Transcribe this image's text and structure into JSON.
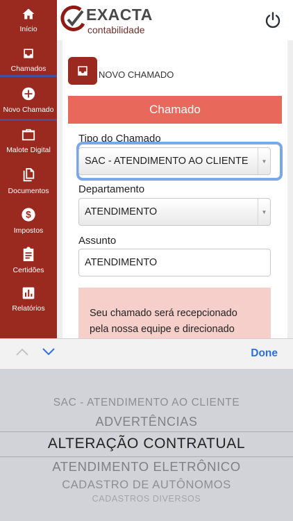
{
  "sidebar": {
    "items": [
      {
        "label": "Início",
        "icon": "home-icon"
      },
      {
        "label": "Chamados",
        "icon": "inbox-icon"
      },
      {
        "label": "Novo Chamado",
        "icon": "add-circle-icon"
      },
      {
        "label": "Malote Digital",
        "icon": "briefcase-icon"
      },
      {
        "label": "Documentos",
        "icon": "documents-icon"
      },
      {
        "label": "Impostos",
        "icon": "dollar-icon"
      },
      {
        "label": "Certidões",
        "icon": "clipboard-icon"
      },
      {
        "label": "Relatórios",
        "icon": "chart-icon"
      }
    ]
  },
  "header": {
    "logo_title": "EXACTA",
    "logo_subtitle": "contabilidade"
  },
  "page": {
    "title": "NOVO CHAMADO",
    "section_title": "Chamado"
  },
  "form": {
    "tipo_label": "Tipo do Chamado",
    "tipo_value": "SAC - ATENDIMENTO AO CLIENTE",
    "departamento_label": "Departamento",
    "departamento_value": "ATENDIMENTO",
    "assunto_label": "Assunto",
    "assunto_value": "ATENDIMENTO",
    "notice_line1": "Seu chamado será recepcionado",
    "notice_line2": "pela nossa equipe e direcionado"
  },
  "keyboard_toolbar": {
    "done_label": "Done"
  },
  "picker": {
    "options": [
      "SAC - ATENDIMENTO AO CLIENTE",
      "ADVERTÊNCIAS",
      "ALTERAÇÃO CONTRATUAL",
      "ATENDIMENTO ELETRÔNICO",
      "CADASTRO DE AUTÔNOMOS",
      "CADASTROS DIVERSOS"
    ],
    "selected": "ALTERAÇÃO CONTRATUAL"
  },
  "colors": {
    "sidebar": "#9a2a1f",
    "section_bar": "#e8685b",
    "focus_ring": "#7aa7e8",
    "done": "#2d6fe0"
  }
}
